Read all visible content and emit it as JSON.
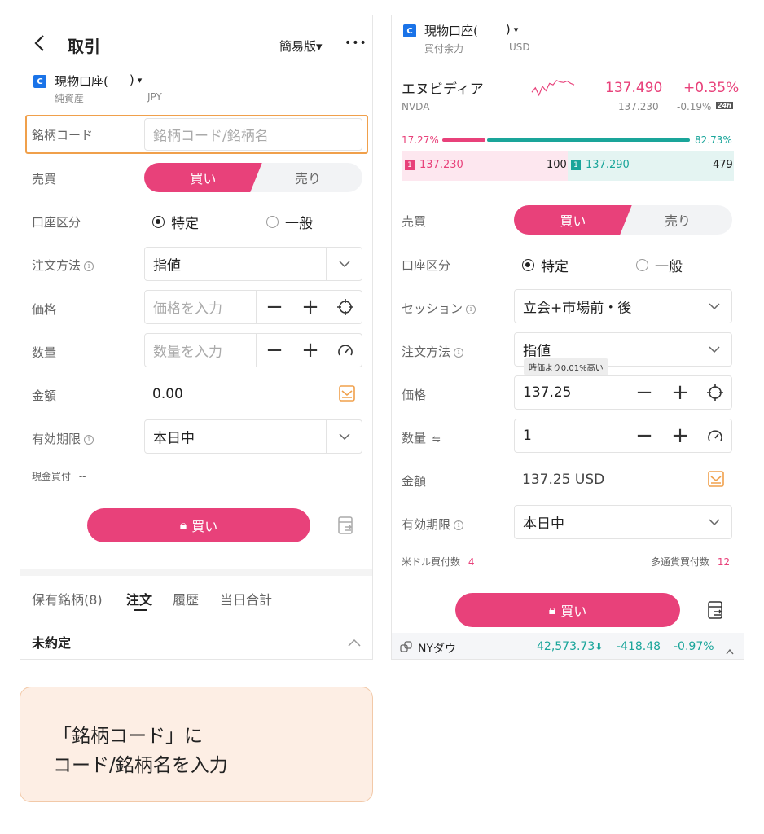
{
  "colors": {
    "accent": "#e8417a",
    "teal": "#1aa59a",
    "highlight": "#f0a04b",
    "account_icon": "#1a73e8"
  },
  "left": {
    "header": {
      "title": "取引",
      "mode": "簡易版▾",
      "more": "•••"
    },
    "account": {
      "name": "現物口座(",
      "paren_close": ")",
      "caret": "▾",
      "sub_label": "純資産",
      "currency": "JPY"
    },
    "fields": {
      "code_label": "銘柄コード",
      "code_placeholder": "銘柄コード/銘柄名",
      "side_label": "売買",
      "buy": "買い",
      "sell": "売り",
      "account_type_label": "口座区分",
      "tokutei": "特定",
      "ippan": "一般",
      "order_method_label": "注文方法",
      "order_method_value": "指値",
      "price_label": "価格",
      "price_placeholder": "価格を入力",
      "qty_label": "数量",
      "qty_placeholder": "数量を入力",
      "amount_label": "金額",
      "amount_value": "0.00",
      "expiry_label": "有効期限",
      "expiry_value": "本日中",
      "cash_label": "現金買付",
      "cash_value": "--"
    },
    "submit": "買い",
    "tabs": [
      "保有銘柄(8)",
      "注文",
      "履歴",
      "当日合計"
    ],
    "section": "未約定"
  },
  "right": {
    "account": {
      "name": "現物口座(",
      "paren_close": ")",
      "caret": "▾",
      "sub_label": "買付余力",
      "currency": "USD"
    },
    "quote": {
      "name": "エヌビディア",
      "ticker": "NVDA",
      "price": "137.490",
      "change_pct": "+0.35%",
      "ext_price": "137.230",
      "ext_change_pct": "-0.19%",
      "ext_badge": "24h",
      "sparkline": [
        0.55,
        0.7,
        0.45,
        0.75,
        0.6,
        0.85,
        0.8,
        0.95,
        0.9,
        0.88,
        0.93,
        0.85,
        0.8
      ],
      "bid_ratio_label": "17.27%",
      "ask_ratio_label": "82.73%",
      "bid_ratio": 0.1727,
      "bid_num": "1",
      "bid_price": "137.230",
      "bid_size": "100",
      "ask_num": "1",
      "ask_price": "137.290",
      "ask_size": "479"
    },
    "fields": {
      "side_label": "売買",
      "buy": "買い",
      "sell": "売り",
      "account_type_label": "口座区分",
      "tokutei": "特定",
      "ippan": "一般",
      "session_label": "セッション",
      "session_value": "立会+市場前・後",
      "order_method_label": "注文方法",
      "order_method_value": "指値",
      "tooltip": "時価より0.01%高い",
      "price_label": "価格",
      "price_value": "137.25",
      "qty_label": "数量",
      "qty_suffix": "⇋",
      "qty_value": "1",
      "amount_label": "金額",
      "amount_value": "137.25 USD",
      "expiry_label": "有効期限",
      "expiry_value": "本日中",
      "usd_buy_label": "米ドル買付数",
      "usd_buy_count": "4",
      "multi_buy_label": "多通貨買付数",
      "multi_buy_count": "12"
    },
    "submit": "買い",
    "ticker_bar": {
      "name": "NYダウ",
      "value": "42,573.73",
      "change": "-418.48",
      "pct": "-0.97%"
    }
  },
  "callout": {
    "line1": "「銘柄コード」に",
    "line2": "コード/銘柄名を入力"
  }
}
